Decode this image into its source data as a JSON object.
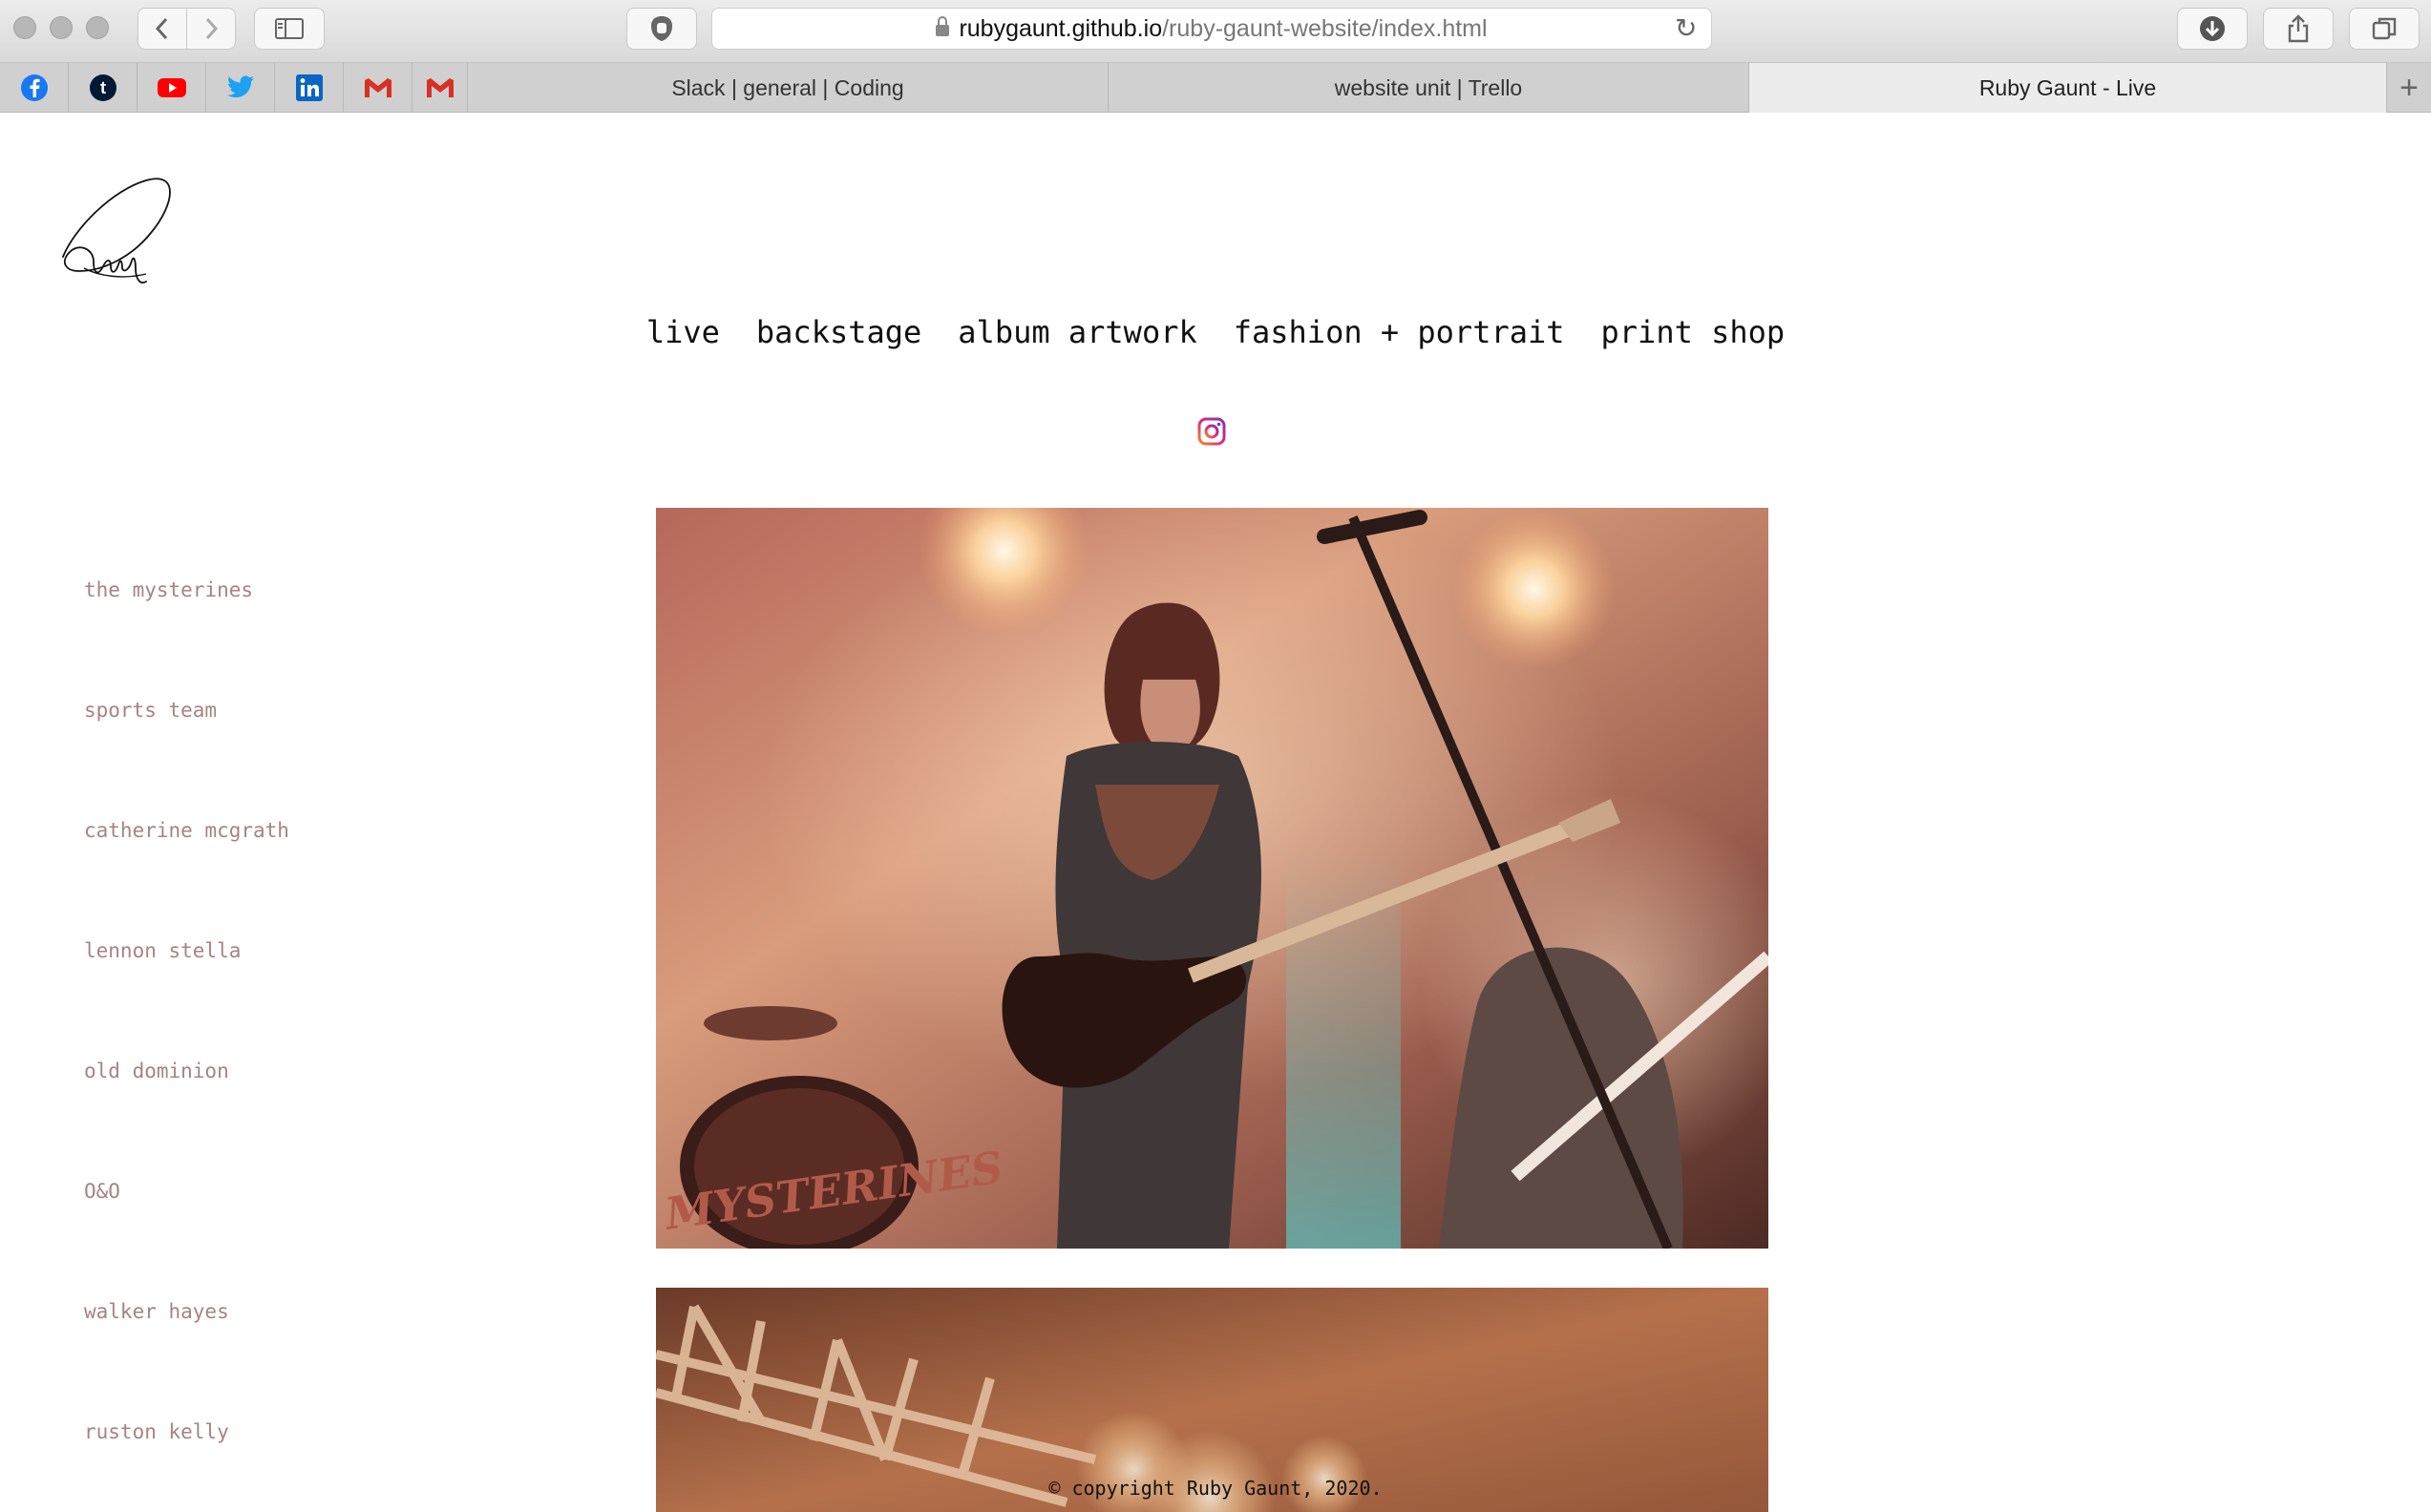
{
  "browser": {
    "url_host": "rubygaunt.github.io",
    "url_path": "/ruby-gaunt-website/index.html",
    "pinned_tabs": [
      {
        "icon": "facebook-icon",
        "color": "#1877f2"
      },
      {
        "icon": "tumblr-icon",
        "color": "#001935"
      },
      {
        "icon": "youtube-icon",
        "color": "#ff0000"
      },
      {
        "icon": "twitter-icon",
        "color": "#1da1f2"
      },
      {
        "icon": "linkedin-icon",
        "color": "#0a66c2"
      },
      {
        "icon": "gmail-icon",
        "color": "#d93025"
      },
      {
        "icon": "gmail-icon",
        "color": "#d93025"
      }
    ],
    "tabs": [
      {
        "label": "Slack | general | Coding"
      },
      {
        "label": "website unit | Trello"
      },
      {
        "label": "Ruby Gaunt - Live",
        "active": true
      }
    ]
  },
  "site": {
    "logo_alt": "Ruby",
    "nav": [
      "live",
      "backstage",
      "album artwork",
      "fashion + portrait",
      "print shop"
    ],
    "sidebar": [
      "the mysterines",
      "sports team",
      "catherine mcgrath",
      "lennon stella",
      "old dominion",
      "O&O",
      "walker hayes",
      "ruston kelly"
    ],
    "photo_text": "THE MYSTERINES",
    "footer": "© copyright Ruby Gaunt, 2020."
  },
  "colors": {
    "sidebar_link": "#a78383",
    "instagram_gradient": [
      "#f58529",
      "#dd2a7b",
      "#8134af"
    ]
  }
}
